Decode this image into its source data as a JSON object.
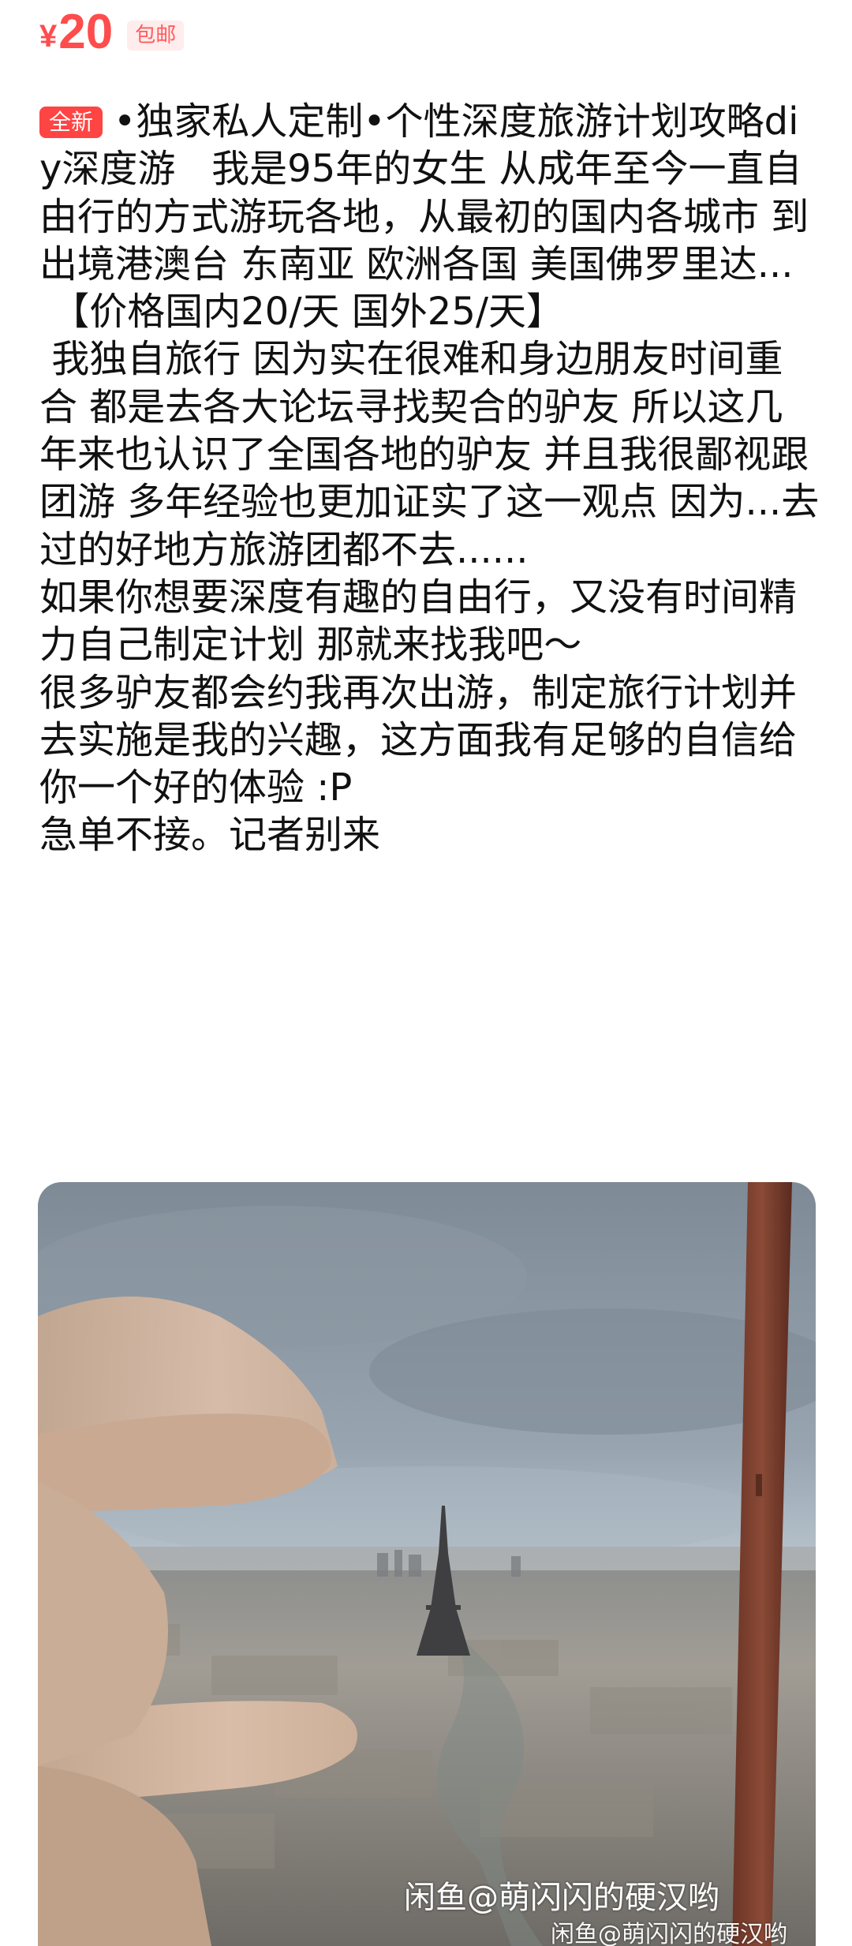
{
  "listing": {
    "currency": "¥",
    "price": "20",
    "shipping_badge": "包邮",
    "condition_badge": "全新",
    "description": "•独家私人定制•个性深度旅游计划攻略diy深度游   我是95年的女生 从成年至今一直自由行的方式游玩各地，从最初的国内各城市 到出境港澳台 东南亚 欧洲各国 美国佛罗里达...\n 【价格国内20/天 国外25/天】\n 我独自旅行 因为实在很难和身边朋友时间重合 都是去各大论坛寻找契合的驴友 所以这几年来也认识了全国各地的驴友 并且我很鄙视跟团游 多年经验也更加证实了这一观点 因为...去过的好地方旅游团都不去......\n如果你想要深度有趣的自由行，又没有时间精力自己制定计划 那就来找我吧～\n很多驴友都会约我再次出游，制定旅行计划并去实施是我的兴趣，这方面我有足够的自信给你一个好的体验 :P\n急单不接。记者别来"
  },
  "photo": {
    "watermark_main": "闲鱼@萌闪闪的硬汉哟",
    "watermark_secondary": "闲鱼@萌闪闪的硬汉哟"
  },
  "colors": {
    "price_red": "#ff4c4c",
    "badge_red": "#ff4444",
    "badge_pink_bg": "#ffecec"
  }
}
